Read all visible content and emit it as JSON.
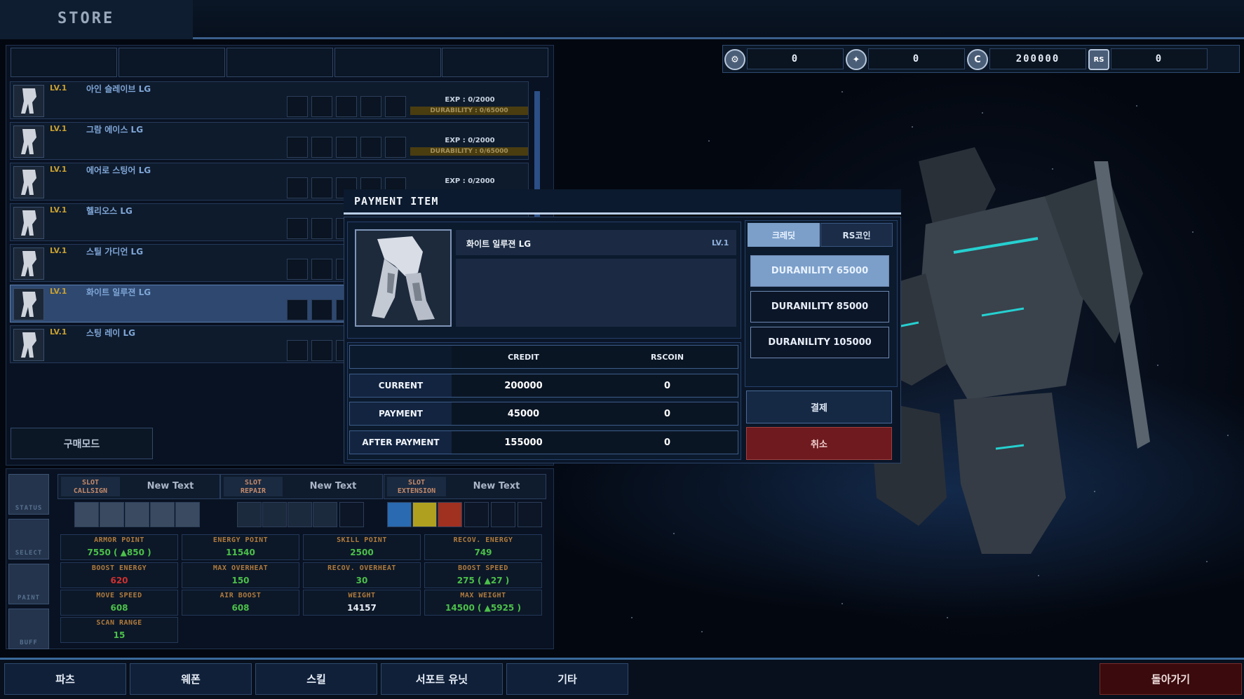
{
  "header": {
    "title": "STORE"
  },
  "currency": [
    {
      "icon": "wrench-icon",
      "value": "0"
    },
    {
      "icon": "emblem-icon",
      "value": "0"
    },
    {
      "icon": "credit-icon",
      "value": "200000"
    },
    {
      "icon": "rs-coin-icon",
      "value": "0"
    }
  ],
  "items": [
    {
      "lv": "LV.1",
      "name": "아인 슬레이브 LG",
      "exp": "EXP : 0/2000",
      "durability": "DURABILITY : 0/65000"
    },
    {
      "lv": "LV.1",
      "name": "그람 에이스 LG",
      "exp": "EXP : 0/2000",
      "durability": "DURABILITY : 0/65000"
    },
    {
      "lv": "LV.1",
      "name": "에어로 스팅어 LG",
      "exp": "EXP : 0/2000"
    },
    {
      "lv": "LV.1",
      "name": "헬리오스 LG"
    },
    {
      "lv": "LV.1",
      "name": "스틸 가디언 LG"
    },
    {
      "lv": "LV.1",
      "name": "화이트 일루젼 LG",
      "selected": true
    },
    {
      "lv": "LV.1",
      "name": "스팅 레이 LG"
    }
  ],
  "buy_mode_label": "구매모드",
  "side_nav": [
    "STATUS",
    "SELECT",
    "PAINT",
    "BUFF"
  ],
  "slot_sections": [
    {
      "title_line1": "SLOT",
      "title_line2": "CALLSIGN",
      "text": "New Text"
    },
    {
      "title_line1": "SLOT",
      "title_line2": "REPAIR",
      "text": "New Text"
    },
    {
      "title_line1": "SLOT",
      "title_line2": "EXTENSION",
      "text": "New Text"
    }
  ],
  "stats": [
    {
      "label": "ARMOR POINT",
      "value": "7550 ( ▲850 )",
      "color": "#4cc04a"
    },
    {
      "label": "ENERGY POINT",
      "value": "11540",
      "color": "#4cc04a"
    },
    {
      "label": "SKILL POINT",
      "value": "2500",
      "color": "#4cc04a"
    },
    {
      "label": "RECOV. ENERGY",
      "value": "749",
      "color": "#4cc04a"
    },
    {
      "label": "BOOST ENERGY",
      "value": "620",
      "color": "#d03030"
    },
    {
      "label": "MAX OVERHEAT",
      "value": "150",
      "color": "#4cc04a"
    },
    {
      "label": "RECOV. OVERHEAT",
      "value": "30",
      "color": "#4cc04a"
    },
    {
      "label": "BOOST SPEED",
      "value": "275 ( ▲27 )",
      "color": "#4cc04a"
    },
    {
      "label": "MOVE SPEED",
      "value": "608",
      "color": "#4cc04a"
    },
    {
      "label": "AIR BOOST",
      "value": "608",
      "color": "#4cc04a"
    },
    {
      "label": "WEIGHT",
      "value": "14157",
      "color": "#e6ecf5"
    },
    {
      "label": "MAX WEIGHT",
      "value": "14500 ( ▲5925 )",
      "color": "#4cc04a"
    },
    {
      "label": "SCAN RANGE",
      "value": "15",
      "color": "#4cc04a"
    }
  ],
  "bottom_nav": [
    "파츠",
    "웨폰",
    "스킬",
    "서포트 유닛",
    "기타"
  ],
  "back_label": "돌아가기",
  "payment": {
    "title": "PAYMENT ITEM",
    "item_name": "화이트 일루젼 LG",
    "item_lv": "LV.1",
    "tabs": [
      "크레딧",
      "RS코인"
    ],
    "options": [
      "DURANILITY 65000",
      "DURANILITY 85000",
      "DURANILITY 105000"
    ],
    "columns": [
      "CREDIT",
      "RSCOIN"
    ],
    "rows": [
      {
        "label": "CURRENT",
        "credit": "200000",
        "rscoin": "0"
      },
      {
        "label": "PAYMENT",
        "credit": "45000",
        "rscoin": "0"
      },
      {
        "label": "AFTER PAYMENT",
        "credit": "155000",
        "rscoin": "0"
      }
    ],
    "pay_label": "결제",
    "cancel_label": "취소"
  }
}
